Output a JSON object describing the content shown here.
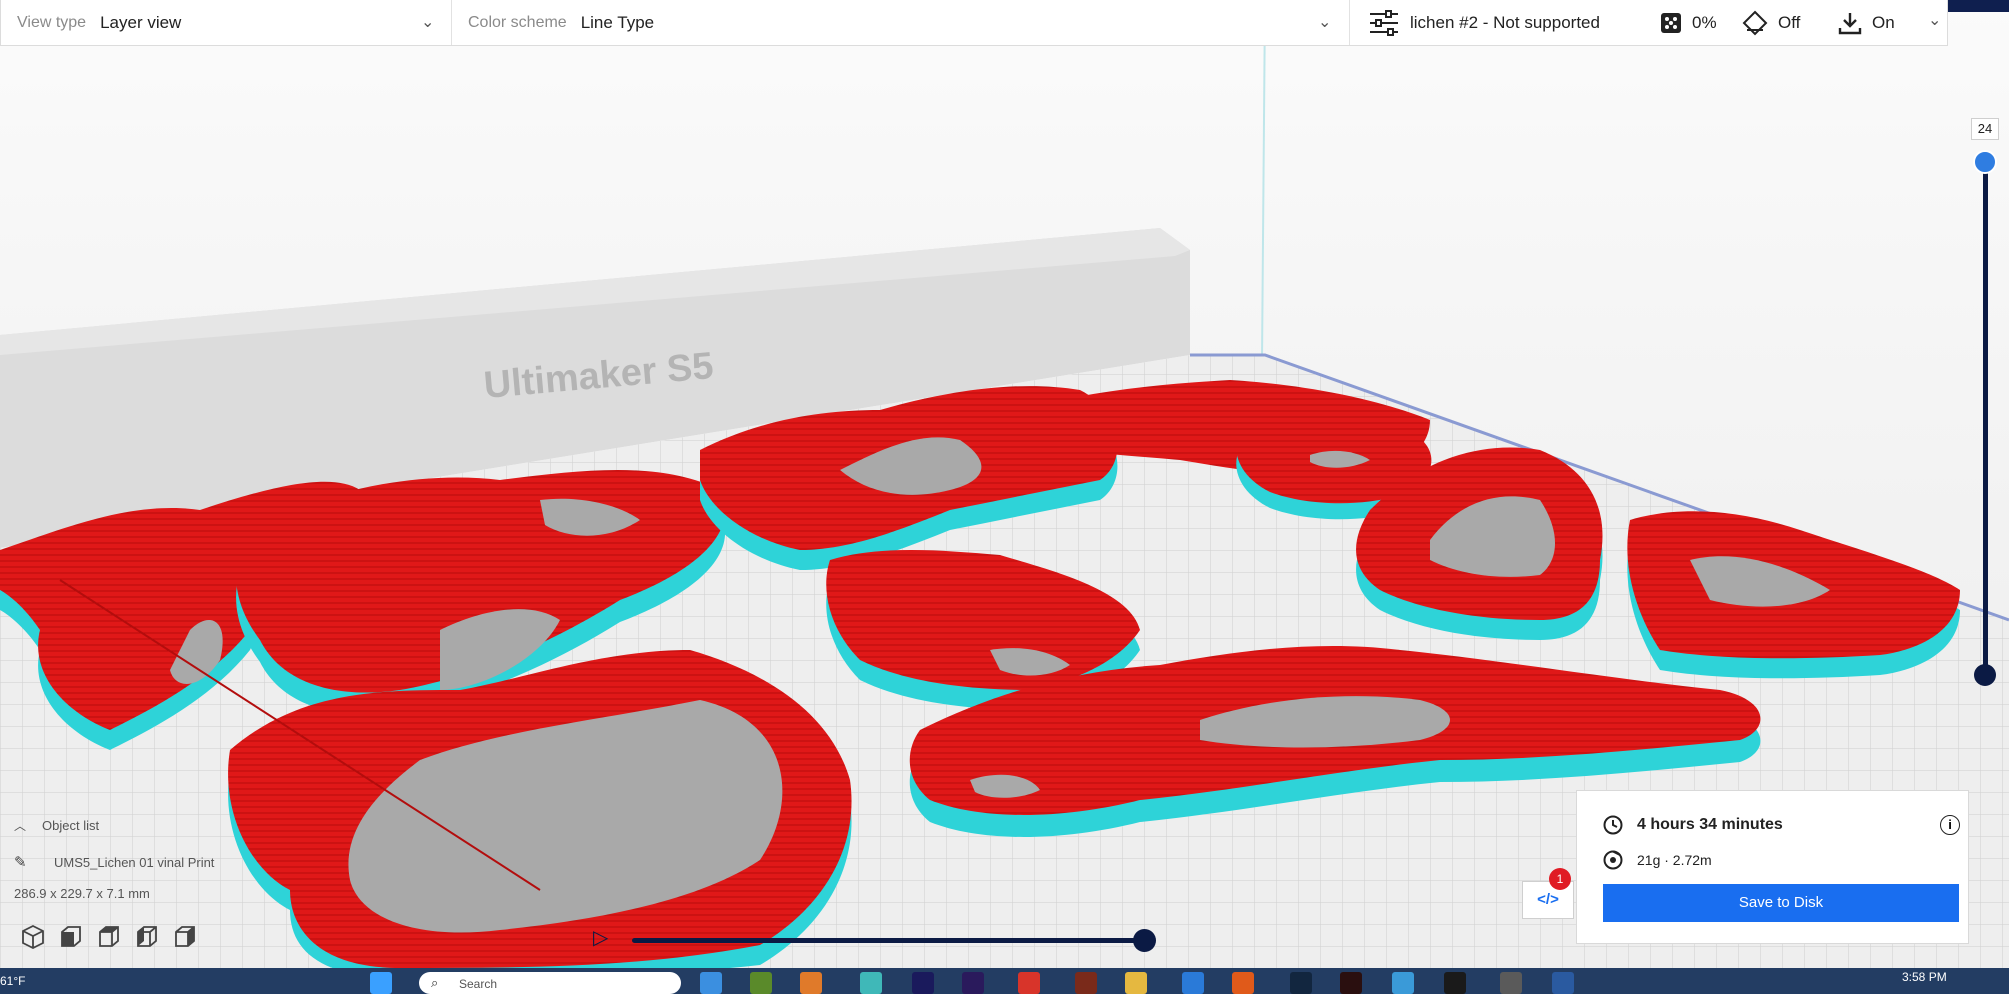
{
  "toolbar": {
    "view_type_label": "View type",
    "view_type_value": "Layer view",
    "color_scheme_label": "Color scheme",
    "color_scheme_value": "Line Type",
    "print_profile": "lichen #2 - Not supported",
    "infill": "0%",
    "support": "Off",
    "adhesion": "On"
  },
  "scene": {
    "printer_name": "Ultimaker S5"
  },
  "layer_slider": {
    "current_layer": "24"
  },
  "object_list": {
    "header": "Object list",
    "file_name": "UMS5_Lichen 01 vinal Print",
    "dimensions": "286.9 x 229.7 x 7.1 mm"
  },
  "print_info": {
    "time": "4 hours 34 minutes",
    "material": "21g · 2.72m",
    "save_label": "Save to Disk",
    "gcode_badge": "1"
  },
  "taskbar": {
    "temperature": "61°F",
    "search_placeholder": "Search",
    "time": "3:58 PM"
  },
  "colors": {
    "wall_red": "#e01818",
    "skirt_cyan": "#2ed3d8",
    "infill_gray": "#a9a9a9",
    "accent_blue": "#196ef0",
    "navy": "#0b1a44"
  },
  "icons": [
    "settings-sliders-icon",
    "infill-icon",
    "support-icon",
    "adhesion-icon",
    "chevron-down-icon",
    "clock-icon",
    "spool-icon",
    "info-icon",
    "pencil-icon",
    "gcode-icon",
    "play-icon"
  ]
}
